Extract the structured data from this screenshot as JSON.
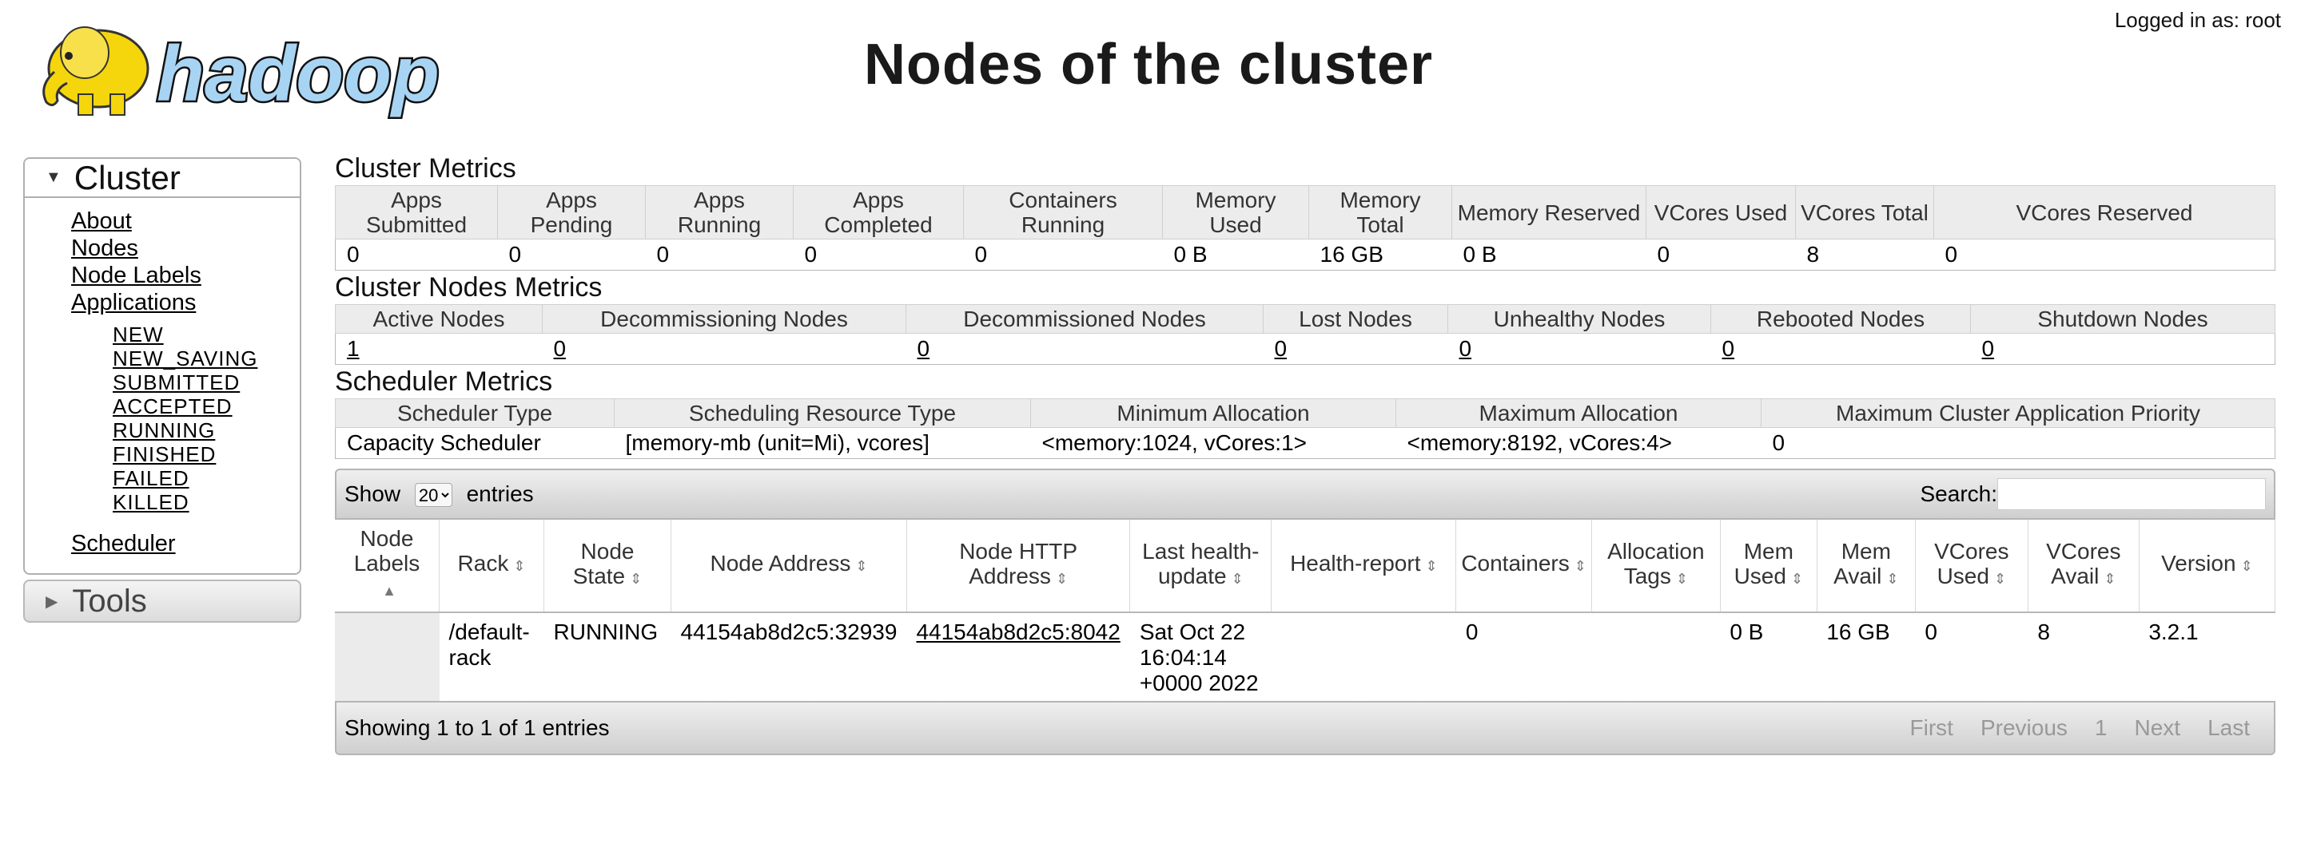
{
  "header": {
    "title": "Nodes of the cluster",
    "logged_in": "Logged in as: root",
    "logo_text": "hadoop"
  },
  "sidebar": {
    "cluster_label": "Cluster",
    "links": [
      "About",
      "Nodes",
      "Node Labels",
      "Applications"
    ],
    "app_states": [
      "NEW",
      "NEW_SAVING",
      "SUBMITTED",
      "ACCEPTED",
      "RUNNING",
      "FINISHED",
      "FAILED",
      "KILLED"
    ],
    "scheduler": "Scheduler",
    "tools_label": "Tools"
  },
  "cluster_metrics": {
    "title": "Cluster Metrics",
    "headers": [
      "Apps Submitted",
      "Apps Pending",
      "Apps Running",
      "Apps Completed",
      "Containers Running",
      "Memory Used",
      "Memory Total",
      "Memory Reserved",
      "VCores Used",
      "VCores Total",
      "VCores Reserved"
    ],
    "values": [
      "0",
      "0",
      "0",
      "0",
      "0",
      "0 B",
      "16 GB",
      "0 B",
      "0",
      "8",
      "0"
    ]
  },
  "nodes_metrics": {
    "title": "Cluster Nodes Metrics",
    "headers": [
      "Active Nodes",
      "Decommissioning Nodes",
      "Decommissioned Nodes",
      "Lost Nodes",
      "Unhealthy Nodes",
      "Rebooted Nodes",
      "Shutdown Nodes"
    ],
    "values": [
      "1",
      "0",
      "0",
      "0",
      "0",
      "0",
      "0"
    ]
  },
  "scheduler_metrics": {
    "title": "Scheduler Metrics",
    "headers": [
      "Scheduler Type",
      "Scheduling Resource Type",
      "Minimum Allocation",
      "Maximum Allocation",
      "Maximum Cluster Application Priority"
    ],
    "values": [
      "Capacity Scheduler",
      "[memory-mb (unit=Mi), vcores]",
      "<memory:1024, vCores:1>",
      "<memory:8192, vCores:4>",
      "0"
    ]
  },
  "nodes_table": {
    "show_label": "Show",
    "entries_label": "entries",
    "page_size": "20",
    "search_label": "Search:",
    "headers": [
      "Node Labels",
      "Rack",
      "Node State",
      "Node Address",
      "Node HTTP Address",
      "Last health-update",
      "Health-report",
      "Containers",
      "Allocation Tags",
      "Mem Used",
      "Mem Avail",
      "VCores Used",
      "VCores Avail",
      "Version"
    ],
    "row": {
      "node_labels": "",
      "rack": "/default-rack",
      "state": "RUNNING",
      "address": "44154ab8d2c5:32939",
      "http_address": "44154ab8d2c5:8042",
      "last_health_update": "Sat Oct 22 16:04:14 +0000 2022",
      "health_report": "",
      "containers": "0",
      "allocation_tags": "",
      "mem_used": "0 B",
      "mem_avail": "16 GB",
      "vcores_used": "0",
      "vcores_avail": "8",
      "version": "3.2.1"
    },
    "info": "Showing 1 to 1 of 1 entries",
    "pager": {
      "first": "First",
      "previous": "Previous",
      "page": "1",
      "next": "Next",
      "last": "Last"
    }
  }
}
